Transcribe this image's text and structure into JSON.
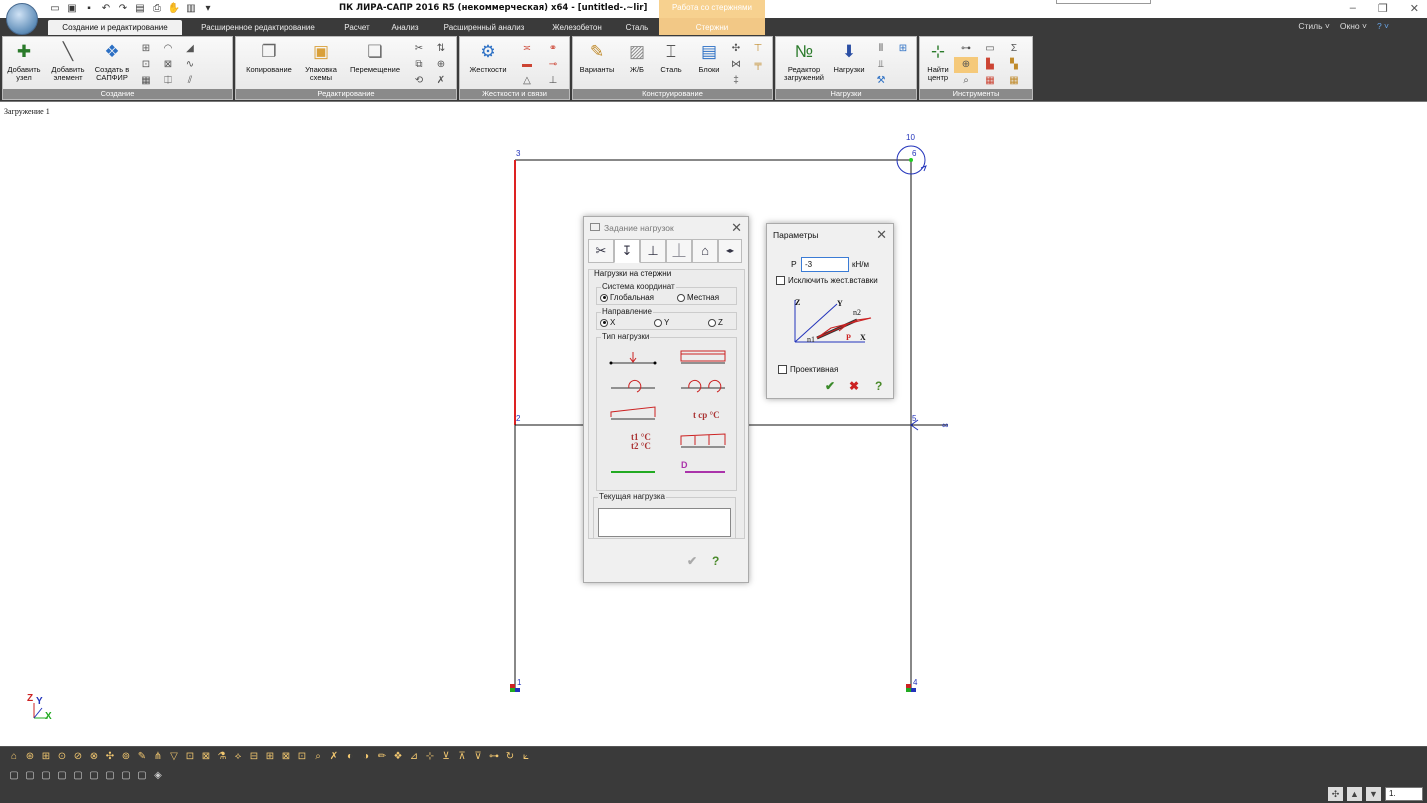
{
  "window": {
    "title": "ПК ЛИРА-САПР  2016 R5 (некоммерческая) x64 - [untitled-.~lir]",
    "context_tab_header": "Работа со стержнями",
    "controls": [
      "–",
      "❐",
      "✕"
    ]
  },
  "qat": {
    "icons": [
      "new-icon",
      "open-icon",
      "save-icon",
      "undo-icon",
      "redo-icon",
      "book-icon",
      "print-icon",
      "hand-icon",
      "chart-icon",
      "customize-icon"
    ]
  },
  "tabs": [
    {
      "label": "Создание и редактирование"
    },
    {
      "label": "Расширенное редактирование"
    },
    {
      "label": "Расчет"
    },
    {
      "label": "Анализ"
    },
    {
      "label": "Расширенный анализ"
    },
    {
      "label": "Железобетон"
    },
    {
      "label": "Сталь"
    },
    {
      "label": "Стержни"
    }
  ],
  "tabbar_right": {
    "style": "Стиль ˅",
    "window": "Окно ˅",
    "help": "? ˅"
  },
  "ribbon": {
    "groups": [
      {
        "label": "Создание",
        "buttons": [
          "Добавить узел",
          "Добавить элемент",
          "Создать в САПФИР"
        ]
      },
      {
        "label": "Редактирование",
        "buttons": [
          "Копирование",
          "Упаковка схемы",
          "Перемещение"
        ]
      },
      {
        "label": "Жесткости и связи",
        "buttons": [
          "Жесткости"
        ]
      },
      {
        "label": "Конструирование",
        "buttons": [
          "Варианты",
          "Ж/Б",
          "Сталь",
          "Блоки"
        ]
      },
      {
        "label": "Нагрузки",
        "buttons": [
          "Редактор загружений",
          "Нагрузки"
        ]
      },
      {
        "label": "Инструменты",
        "buttons": [
          "Найти центр"
        ]
      }
    ]
  },
  "canvas": {
    "loadcase": "Загружение 1",
    "nodes": [
      "1",
      "2",
      "3",
      "4",
      "5",
      "6",
      "10"
    ],
    "infinity": "∞",
    "axes": {
      "z": "Z",
      "y": "Y",
      "x": "X"
    }
  },
  "loads_dialog": {
    "title": "Задание нагрузок",
    "section": "Нагрузки на стержни",
    "coord_system": {
      "legend": "Система координат",
      "global": "Глобальная",
      "local": "Местная",
      "selected": "global"
    },
    "direction": {
      "legend": "Направление",
      "x": "X",
      "y": "Y",
      "z": "Z",
      "selected": "x"
    },
    "load_type": {
      "legend": "Тип нагрузки",
      "temp1": "t1 °C",
      "temp2": "t2 °C",
      "tcp": "t ср °C",
      "dist": "D"
    },
    "current_load": {
      "legend": "Текущая нагрузка",
      "value": ""
    },
    "ok": "✔",
    "help": "?"
  },
  "params_dialog": {
    "title": "Параметры",
    "p_label": "P",
    "p_value": "-3",
    "unit": "кН/м",
    "exclude_rigid": "Исключить жест.вставки",
    "projective": "Проективная",
    "diagram": {
      "z": "Z",
      "y": "Y",
      "x": "X",
      "n1": "n1",
      "n2": "n2",
      "p": "P"
    },
    "ok": "✔",
    "cancel": "✖",
    "help": "?"
  },
  "status": {
    "zoom": "1."
  },
  "colors": {
    "accent": "#f2c886",
    "dark_chrome": "#3a3a3a",
    "red": "#cc2222",
    "blue": "#2233bb"
  }
}
